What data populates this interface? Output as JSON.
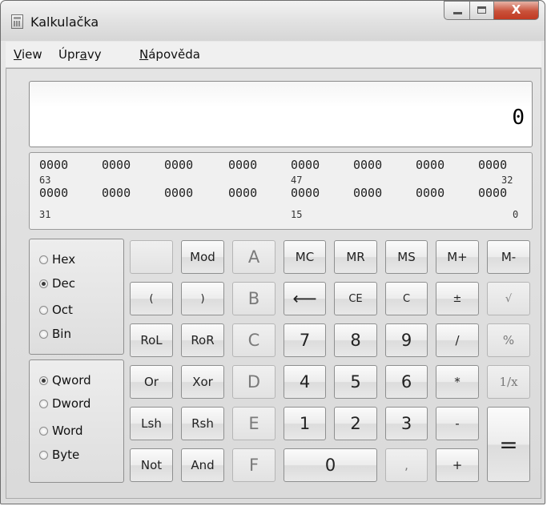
{
  "window": {
    "title": "Kalkulačka",
    "close_glyph": "X"
  },
  "menu": {
    "view": "iew",
    "view_key": "V",
    "edit_pre": "Úpr",
    "edit_key": "a",
    "edit_post": "vy",
    "help_key": "N",
    "help": "ápověda"
  },
  "display": {
    "value": "0"
  },
  "bits": {
    "row1": [
      "0000",
      "0000",
      "0000",
      "0000",
      "0000",
      "0000",
      "0000",
      "0000"
    ],
    "row2": [
      "0000",
      "0000",
      "0000",
      "0000",
      "0000",
      "0000",
      "0000",
      "0000"
    ],
    "idx_row1": [
      "63",
      "47",
      "32"
    ],
    "idx_row2": [
      "31",
      "15",
      "0"
    ]
  },
  "radix": {
    "hex": "Hex",
    "dec": "Dec",
    "oct": "Oct",
    "bin": "Bin",
    "selected": "Dec"
  },
  "word_size": {
    "qword": "Qword",
    "dword": "Dword",
    "word": "Word",
    "byte": "Byte",
    "selected": "Qword"
  },
  "buttons": {
    "blank": "",
    "mod": "Mod",
    "a": "A",
    "mc": "MC",
    "mr": "MR",
    "ms": "MS",
    "mplus": "M+",
    "mminus": "M-",
    "lparen": "(",
    "rparen": ")",
    "b": "B",
    "backspace": "⟵",
    "ce": "CE",
    "c": "C",
    "plusminus": "±",
    "sqrt": "√",
    "rol": "RoL",
    "ror": "RoR",
    "hex_c": "C",
    "n7": "7",
    "n8": "8",
    "n9": "9",
    "divide": "/",
    "percent": "%",
    "or": "Or",
    "xor": "Xor",
    "d": "D",
    "n4": "4",
    "n5": "5",
    "n6": "6",
    "multiply": "*",
    "reciprocal": "1/x",
    "lsh": "Lsh",
    "rsh": "Rsh",
    "e": "E",
    "n1": "1",
    "n2": "2",
    "n3": "3",
    "minus": "-",
    "equals": "=",
    "not": "Not",
    "and": "And",
    "f": "F",
    "n0": "0",
    "decimal": ",",
    "plus": "+"
  }
}
